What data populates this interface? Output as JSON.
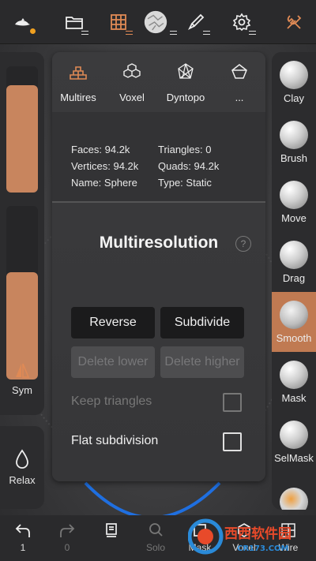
{
  "topbar": {
    "icons": [
      "scene-icon",
      "folder-icon",
      "topology-grid-icon",
      "material-sphere-icon",
      "brush-icon",
      "settings-icon",
      "tools-icon"
    ],
    "accent_dot": "#f0a020"
  },
  "left": {
    "radius_fill": 0.85,
    "intensity_fill": 0.62,
    "sym_label": "Sym",
    "relax_label": "Relax"
  },
  "popup": {
    "tabs": [
      {
        "label": "Multires",
        "icon": "bricks-icon"
      },
      {
        "label": "Voxel",
        "icon": "cubes-icon"
      },
      {
        "label": "Dyntopo",
        "icon": "polygon-icon"
      },
      {
        "label": "...",
        "icon": "pentagon-icon"
      }
    ],
    "info": {
      "faces": "Faces: 94.2k",
      "vertices": "Vertices: 94.2k",
      "name": "Name: Sphere",
      "triangles": "Triangles: 0",
      "quads": "Quads: 94.2k",
      "type": "Type: Static"
    },
    "heading": "Multiresolution",
    "help": "?",
    "buttons": {
      "reverse": "Reverse",
      "subdivide": "Subdivide",
      "delete_lower": "Delete lower",
      "delete_higher": "Delete higher"
    },
    "options": {
      "keep_triangles": "Keep triangles",
      "flat_subdivision": "Flat subdivision"
    }
  },
  "tools": [
    {
      "label": "Clay"
    },
    {
      "label": "Brush"
    },
    {
      "label": "Move"
    },
    {
      "label": "Drag"
    },
    {
      "label": "Smooth",
      "active": true
    },
    {
      "label": "Mask"
    },
    {
      "label": "SelMask"
    }
  ],
  "colors": {
    "accent": "#c07a52",
    "panel": "#2c2c2e"
  },
  "bottom": {
    "undo_count": "1",
    "redo_count": "0",
    "solo": "Solo",
    "mask": "Mask",
    "voxel": "Voxel",
    "wire": "Wire"
  },
  "watermark": {
    "text": "西西软件园",
    "url": "CR173.COM"
  }
}
